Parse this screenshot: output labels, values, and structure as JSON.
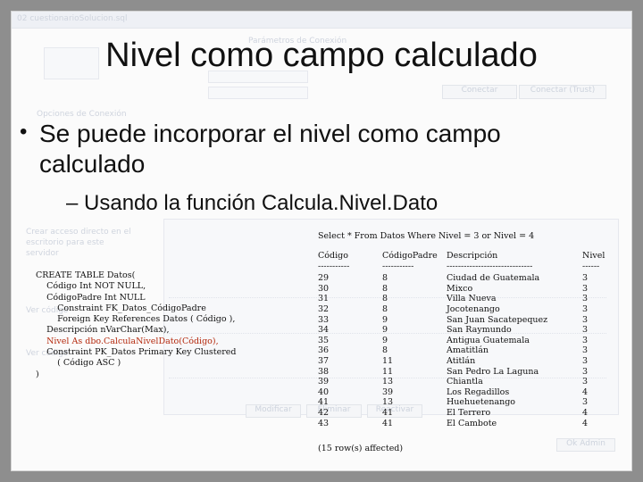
{
  "background_app": {
    "window_title": "02 cuestionarioSolucion.sql",
    "dialog_title": "Parámetros de Conexión",
    "sidebar_labels": [
      "Opciones de Conexión",
      "Crear acceso directo en el",
      "escritorio para este",
      "servidor",
      "Ver código",
      "Ver código"
    ],
    "buttons": [
      "Conectar",
      "Conectar (Trust)",
      "Modificar",
      "Eliminar",
      "Reactivar",
      "Ok Admin"
    ]
  },
  "slide": {
    "title": "Nivel como campo calculado",
    "bullet": "Se puede incorporar el nivel como campo calculado",
    "sub_bullet": "Usando la función Calcula.Nivel.Dato"
  },
  "code": {
    "lines": [
      "CREATE TABLE Datos(",
      "    Código Int NOT NULL,",
      "    CódigoPadre Int NULL",
      "        Constraint FK_Datos_CódigoPadre",
      "        Foreign Key References Datos ( Código ),",
      "    Descripción nVarChar(Max),",
      "    Constraint PK_Datos Primary Key Clustered",
      "        ( Código ASC )",
      ")"
    ],
    "highlight_line": "    Nivel As dbo.CalculaNivelDato(Código),"
  },
  "result": {
    "query": "Select * From Datos Where Nivel = 3 or Nivel = 4",
    "headers": [
      "Código",
      "CódigoPadre",
      "Descripción",
      "Nivel"
    ],
    "rows": [
      [
        "29",
        "8",
        "Ciudad de Guatemala",
        "3"
      ],
      [
        "30",
        "8",
        "Mixco",
        "3"
      ],
      [
        "31",
        "8",
        "Villa Nueva",
        "3"
      ],
      [
        "32",
        "8",
        "Jocotenango",
        "3"
      ],
      [
        "33",
        "9",
        "San Juan Sacatepequez",
        "3"
      ],
      [
        "34",
        "9",
        "San Raymundo",
        "3"
      ],
      [
        "35",
        "9",
        "Antigua Guatemala",
        "3"
      ],
      [
        "36",
        "8",
        "Amatitlán",
        "3"
      ],
      [
        "37",
        "11",
        "Atitlán",
        "3"
      ],
      [
        "38",
        "11",
        "San Pedro La Laguna",
        "3"
      ],
      [
        "39",
        "13",
        "Chiantla",
        "3"
      ],
      [
        "40",
        "39",
        "Los Regadillos",
        "4"
      ],
      [
        "41",
        "13",
        "Huehuetenango",
        "3"
      ],
      [
        "42",
        "41",
        "El Terrero",
        "4"
      ],
      [
        "43",
        "41",
        "El Cambote",
        "4"
      ]
    ],
    "rows_affected": "(15 row(s) affected)"
  }
}
